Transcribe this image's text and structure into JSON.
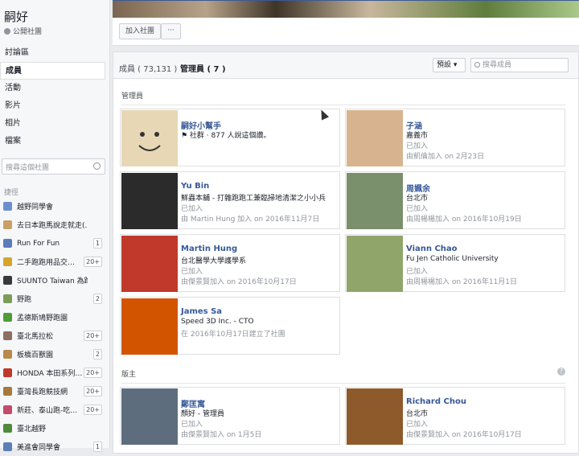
{
  "sidebar": {
    "title": "嗣好",
    "privacy": "公開社團",
    "nav": [
      "討論區",
      "成員",
      "活動",
      "影片",
      "相片",
      "檔案"
    ],
    "search_placeholder": "搜尋這個社團",
    "shortcuts_label": "捷徑",
    "shortcuts": [
      {
        "label": "越野同學會",
        "badge": "",
        "icon_color": "#6d8fcf"
      },
      {
        "label": "去日本跑馬說走就走(…",
        "badge": "",
        "icon_color": "#c9a06a"
      },
      {
        "label": "Run For Fun",
        "badge": "1",
        "icon_color": "#5b7db8"
      },
      {
        "label": "二手跑跑用品交…",
        "badge": "20+",
        "icon_color": "#d4a72c"
      },
      {
        "label": "SUUNTO Taiwan 為跑…",
        "badge": "",
        "icon_color": "#3a3a3a"
      },
      {
        "label": "野跑",
        "badge": "2",
        "icon_color": "#7d9c5a"
      },
      {
        "label": "孟德斯鳩野跑園",
        "badge": "",
        "icon_color": "#4e9b3a"
      },
      {
        "label": "臺北馬拉松",
        "badge": "20+",
        "icon_color": "#8d6e63"
      },
      {
        "label": "板橋百獸園",
        "badge": "2",
        "icon_color": "#b98a4a"
      },
      {
        "label": "HONDA 本田系列…",
        "badge": "20+",
        "icon_color": "#c0392b"
      },
      {
        "label": "臺灣長跑競技網",
        "badge": "20+",
        "icon_color": "#a57a3e"
      },
      {
        "label": "新莊、泰山跑-吃…",
        "badge": "20+",
        "icon_color": "#c24b6e"
      },
      {
        "label": "臺北越野",
        "badge": "",
        "icon_color": "#4f8b3a"
      },
      {
        "label": "美進會同學會",
        "badge": "1",
        "icon_color": "#5c7fb5"
      }
    ]
  },
  "actions": {
    "join": "加入社團",
    "more": "···"
  },
  "tabs": {
    "members": "成員 ( 73,131 )",
    "admins": "管理員 ( 7 )"
  },
  "sort": "預設 ▾",
  "member_search_placeholder": "搜尋成員",
  "sections": {
    "admins": "管理員",
    "moderators": "版主"
  },
  "admins": [
    {
      "name": "嗣好小幫手",
      "l1": "⚑ 社群 · 877 人說這個讚。",
      "l2": "",
      "l3": "",
      "pic": "#e8d7b5"
    },
    {
      "name": "子涵",
      "l1": "嘉義市",
      "l2": "已加入",
      "l3": "由凱倫加入 on 2月23日",
      "pic": "#d7b48f"
    },
    {
      "name": "Yu Bin",
      "l1": "鮮蟲本舖 - 打雜跑跑工兼臨掃地清潔之小小兵",
      "l2": "已加入",
      "l3": "由 Martin Hung 加入 on 2016年11月7日",
      "pic": "#2b2b2b"
    },
    {
      "name": "周姵余",
      "l1": "台北市",
      "l2": "已加入",
      "l3": "由周楊楊加入 on 2016年10月19日",
      "pic": "#7a8f6b"
    },
    {
      "name": "Martin Hung",
      "l1": "台北醫學大學護學系",
      "l2": "已加入",
      "l3": "由傑景賢加入 on 2016年10月17日",
      "pic": "#c0392b"
    },
    {
      "name": "Viann Chao",
      "l1": "Fu Jen Catholic University",
      "l2": "已加入",
      "l3": "由周楊楊加入 on 2016年11月1日",
      "pic": "#8fa56a"
    },
    {
      "name": "James Sa",
      "l1": "Speed 3D Inc. - CTO",
      "l2": "在 2016年10月17日建立了社團",
      "l3": "",
      "pic": "#d35400"
    }
  ],
  "moderators": [
    {
      "name": "鄭匡寓",
      "l1": "顏好 - 管理員",
      "l2": "已加入",
      "l3": "由傑景賢加入 on 1月5日",
      "pic": "#5d6d7e"
    },
    {
      "name": "Richard Chou",
      "l1": "台北市",
      "l2": "已加入",
      "l3": "由傑景賢加入 on 2016年10月17日",
      "pic": "#8e5a2b"
    }
  ]
}
